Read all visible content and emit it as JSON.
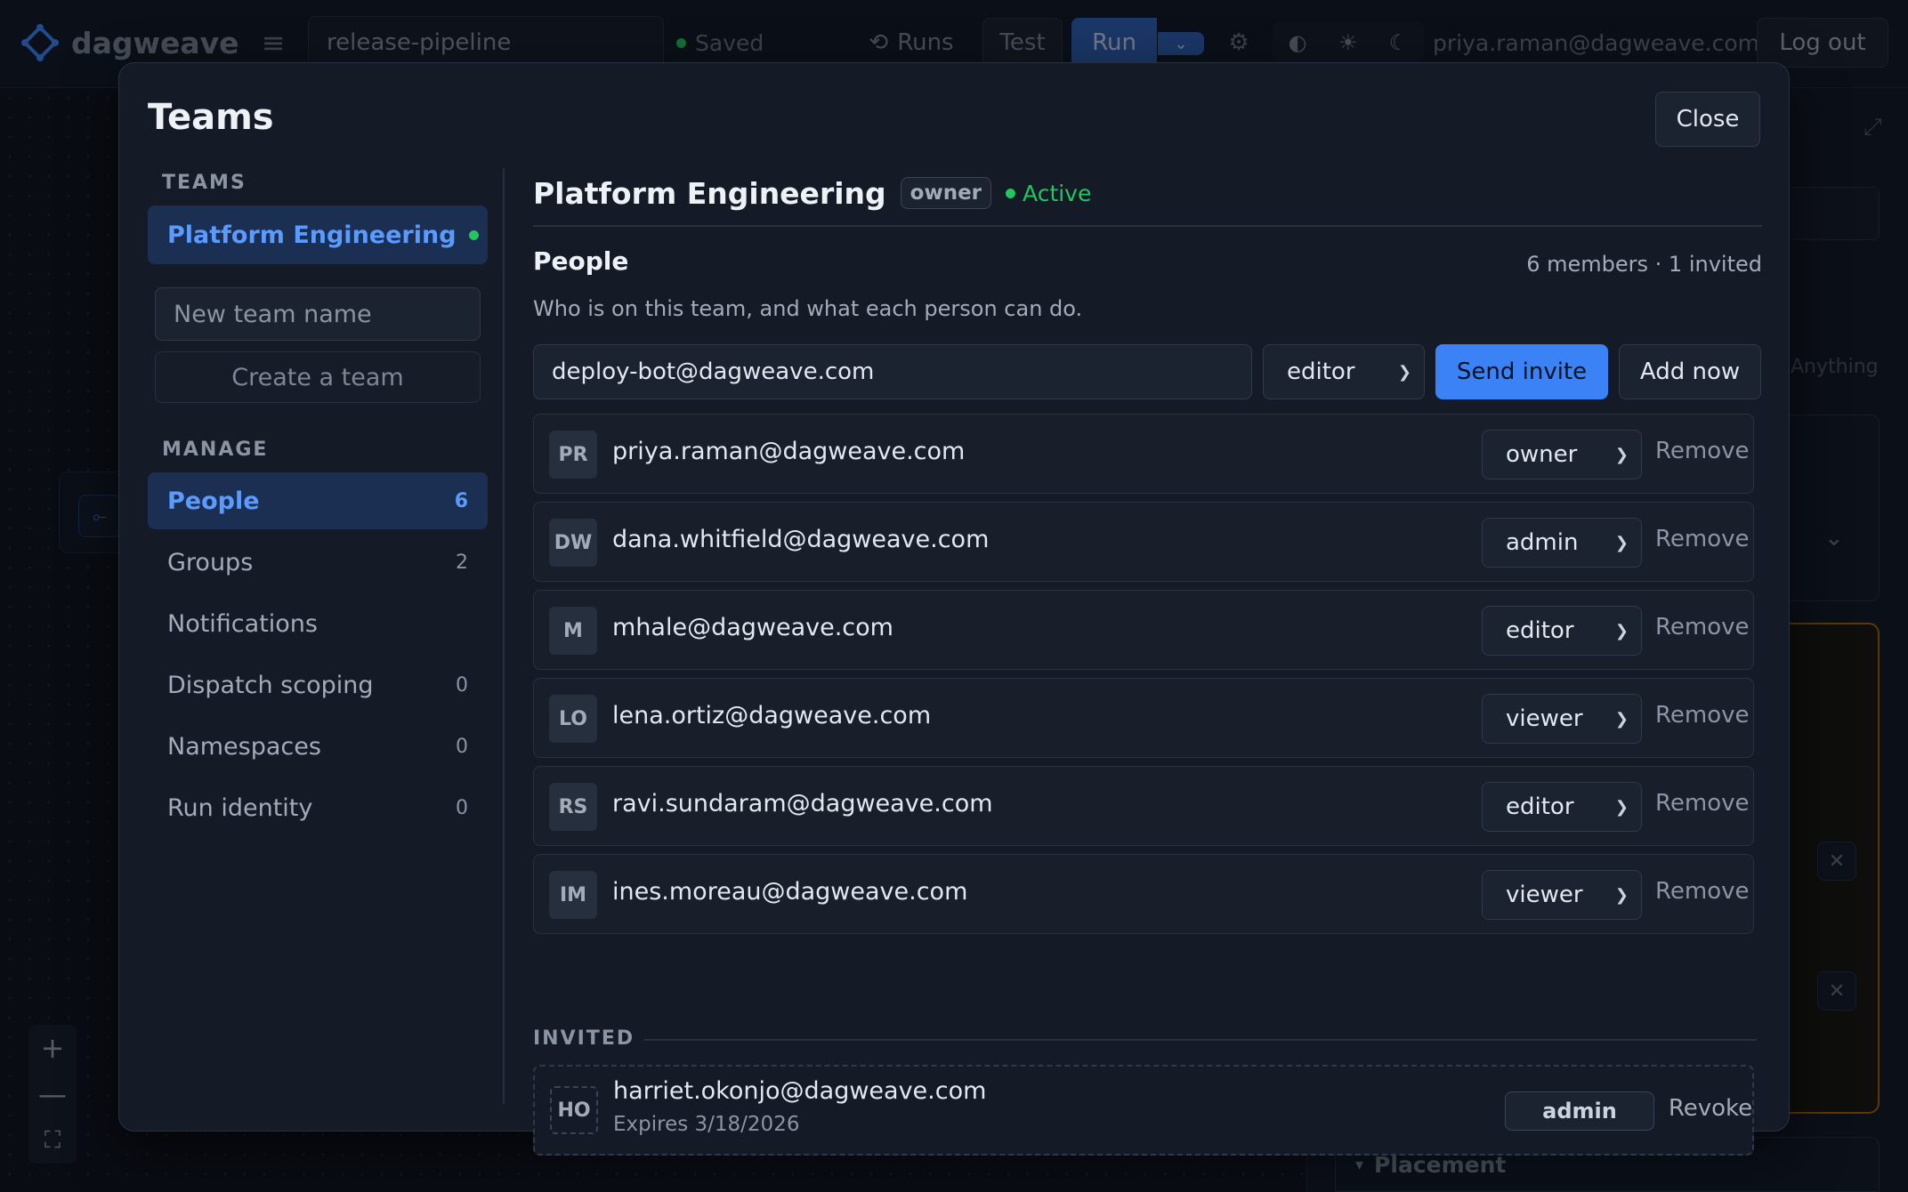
{
  "app": {
    "name": "dagweave",
    "pipeline_name": "release-pipeline",
    "save_status": "Saved",
    "runs_label": "Runs",
    "test_label": "Test",
    "run_label": "Run",
    "user_email": "priya.raman@dagweave.com",
    "logout_label": "Log out"
  },
  "background": {
    "anything_text": "Anything",
    "placement_label": "Placement"
  },
  "modal": {
    "title": "Teams",
    "close_label": "Close",
    "teams_section_label": "TEAMS",
    "teams": [
      {
        "name": "Platform Engineering",
        "status_color": "#22c55e"
      }
    ],
    "new_team_placeholder": "New team name",
    "create_team_label": "Create a team",
    "manage_section_label": "MANAGE",
    "manage_items": [
      {
        "label": "People",
        "count": "6",
        "active": true
      },
      {
        "label": "Groups",
        "count": "2"
      },
      {
        "label": "Notifications",
        "count": ""
      },
      {
        "label": "Dispatch scoping",
        "count": "0"
      },
      {
        "label": "Namespaces",
        "count": "0"
      },
      {
        "label": "Run identity",
        "count": "0"
      }
    ],
    "team": {
      "name": "Platform Engineering",
      "role": "owner",
      "status": "Active"
    },
    "people": {
      "heading": "People",
      "count_text": "6 members · 1 invited",
      "subtitle": "Who is on this team, and what each person can do.",
      "invite_email_value": "deploy-bot@dagweave.com",
      "invite_role": "editor",
      "send_invite_label": "Send invite",
      "add_now_label": "Add now",
      "remove_label": "Remove",
      "members": [
        {
          "initials": "PR",
          "email": "priya.raman@dagweave.com",
          "role": "owner"
        },
        {
          "initials": "DW",
          "email": "dana.whitfield@dagweave.com",
          "role": "admin"
        },
        {
          "initials": "M",
          "email": "mhale@dagweave.com",
          "role": "editor"
        },
        {
          "initials": "LO",
          "email": "lena.ortiz@dagweave.com",
          "role": "viewer"
        },
        {
          "initials": "RS",
          "email": "ravi.sundaram@dagweave.com",
          "role": "editor"
        },
        {
          "initials": "IM",
          "email": "ines.moreau@dagweave.com",
          "role": "viewer"
        }
      ],
      "invited_label": "INVITED",
      "invited": [
        {
          "initials": "HO",
          "email": "harriet.okonjo@dagweave.com",
          "expires": "Expires 3/18/2026",
          "role": "admin",
          "revoke_label": "Revoke"
        }
      ]
    }
  },
  "colors": {
    "accent": "#3b82f6",
    "active_status": "#22c55e",
    "warning_border": "#a16207"
  }
}
